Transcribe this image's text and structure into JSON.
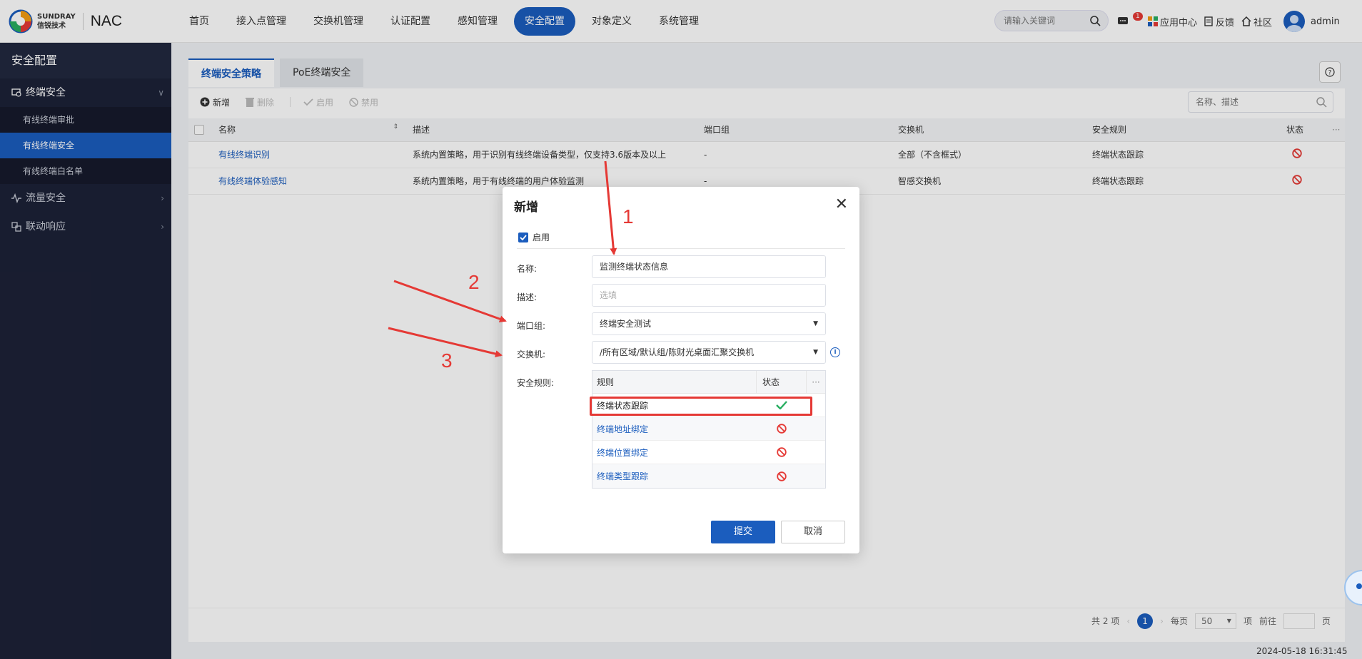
{
  "app": {
    "brand_en": "SUNDRAY",
    "brand_cn": "信锐技术",
    "product": "NAC"
  },
  "nav": [
    {
      "label": "首页",
      "active": false
    },
    {
      "label": "接入点管理",
      "active": false
    },
    {
      "label": "交换机管理",
      "active": false
    },
    {
      "label": "认证配置",
      "active": false
    },
    {
      "label": "感知管理",
      "active": false
    },
    {
      "label": "安全配置",
      "active": true
    },
    {
      "label": "对象定义",
      "active": false
    },
    {
      "label": "系统管理",
      "active": false
    }
  ],
  "top": {
    "search_placeholder": "请输入关键词",
    "msg_count": "1",
    "app_center": "应用中心",
    "feedback": "反馈",
    "community": "社区",
    "user": "admin"
  },
  "sidebar": {
    "title": "安全配置",
    "groups": [
      {
        "label": "终端安全",
        "items": [
          "有线终端审批",
          "有线终端安全",
          "有线终端白名单"
        ],
        "active_item": "有线终端安全"
      },
      {
        "label": "流量安全"
      },
      {
        "label": "联动响应"
      }
    ]
  },
  "tabs": [
    {
      "label": "终端安全策略",
      "active": true
    },
    {
      "label": "PoE终端安全",
      "active": false
    }
  ],
  "toolbar": {
    "add": "新增",
    "delete": "删除",
    "enable": "启用",
    "disable": "禁用",
    "search_placeholder": "名称、描述"
  },
  "table": {
    "headers": [
      "名称",
      "描述",
      "端口组",
      "交换机",
      "安全规则",
      "状态",
      "···"
    ],
    "rows": [
      {
        "name": "有线终端识别",
        "desc": "系统内置策略，用于识别有线终端设备类型，仅支持3.6版本及以上",
        "port_group": "-",
        "switch": "全部（不含框式）",
        "rule": "终端状态跟踪",
        "status": "disabled"
      },
      {
        "name": "有线终端体验感知",
        "desc": "系统内置策略，用于有线终端的用户体验监测",
        "port_group": "-",
        "switch": "智感交换机",
        "rule": "终端状态跟踪",
        "status": "disabled"
      }
    ]
  },
  "pager": {
    "total": "共 2 项",
    "current": "1",
    "per_page_label": "每页",
    "per_page": "50",
    "unit": "项",
    "goto": "前往",
    "page": "页"
  },
  "timestamp": "2024-05-18 16:31:45",
  "modal": {
    "title": "新增",
    "enable_label": "启用",
    "name_label": "名称:",
    "name_value": "监测终端状态信息",
    "desc_label": "描述:",
    "desc_placeholder": "选填",
    "port_group_label": "端口组:",
    "port_group_value": "终端安全测试",
    "switch_label": "交换机:",
    "switch_value": "/所有区域/默认组/陈财光桌面汇聚交换机",
    "rules_label": "安全规则:",
    "rules_header_rule": "规则",
    "rules_header_status": "状态",
    "rules_header_more": "···",
    "rules": [
      {
        "name": "终端状态跟踪",
        "status": "enabled"
      },
      {
        "name": "终端地址绑定",
        "status": "disabled"
      },
      {
        "name": "终端位置绑定",
        "status": "disabled"
      },
      {
        "name": "终端类型跟踪",
        "status": "disabled"
      }
    ],
    "submit": "提交",
    "cancel": "取消"
  },
  "annotations": [
    "1",
    "2",
    "3"
  ],
  "colors": {
    "primary": "#1b5dbe",
    "annotation": "#e53935",
    "sidebar_bg": "#1c2137"
  }
}
